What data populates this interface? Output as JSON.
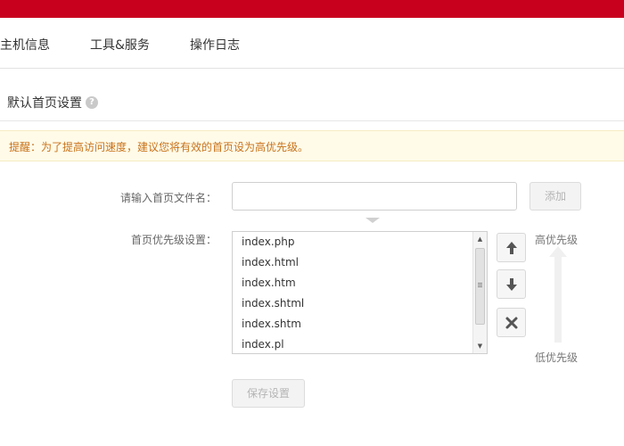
{
  "nav": {
    "items": [
      "主机信息",
      "工具&服务",
      "操作日志"
    ]
  },
  "section": {
    "title": "默认首页设置",
    "help_icon": "question-circle-icon"
  },
  "notice": {
    "text": "提醒：为了提高访问速度，建议您将有效的首页设为高优先级。"
  },
  "form": {
    "filename_label": "请输入首页文件名：",
    "filename_value": "",
    "add_button": "添加",
    "priority_label": "首页优先级设置：",
    "files": [
      "index.php",
      "index.html",
      "index.htm",
      "index.shtml",
      "index.shtm",
      "index.pl"
    ],
    "buttons": {
      "move_up": "arrow-up-icon",
      "move_down": "arrow-down-icon",
      "delete": "close-x-icon"
    },
    "high_priority": "高优先级",
    "low_priority": "低优先级",
    "save_button": "保存设置"
  },
  "colors": {
    "brand": "#c8001e",
    "notice_bg": "#fffbe8",
    "notice_text": "#c8721b"
  }
}
